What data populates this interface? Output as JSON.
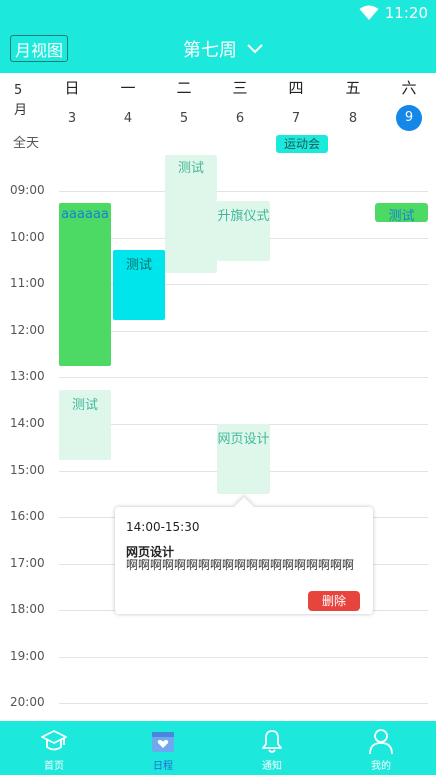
{
  "status_bar": {
    "time": "11:20",
    "wifi_icon": "wifi-icon"
  },
  "header": {
    "month_view_label": "月视图",
    "week_title": "第七周",
    "dropdown_icon": "chevron-down-icon"
  },
  "day_header": {
    "month_label": "5\n月",
    "days": [
      {
        "name": "日",
        "date": "3"
      },
      {
        "name": "一",
        "date": "4"
      },
      {
        "name": "二",
        "date": "5"
      },
      {
        "name": "三",
        "date": "6"
      },
      {
        "name": "四",
        "date": "7"
      },
      {
        "name": "五",
        "date": "8"
      },
      {
        "name": "六",
        "date": "9",
        "today": true
      }
    ],
    "today_color": "#1487e8"
  },
  "all_day": {
    "label": "全天",
    "events": [
      {
        "day": "四",
        "title": "运动会"
      }
    ]
  },
  "hours": [
    "09:00",
    "10:00",
    "11:00",
    "12:00",
    "13:00",
    "14:00",
    "15:00",
    "16:00",
    "17:00",
    "18:00",
    "19:00",
    "20:00"
  ],
  "events": [
    {
      "day": "日",
      "title": "aaaaaa"
    },
    {
      "day": "一",
      "title": "测试"
    },
    {
      "day": "二",
      "title": "测试"
    },
    {
      "day": "三",
      "title": "升旗仪式"
    },
    {
      "day": "六",
      "title": "测试"
    },
    {
      "day": "日",
      "title": "测试"
    },
    {
      "day": "三",
      "title": "网页设计"
    }
  ],
  "popup": {
    "time": "14:00-15:30",
    "title": "网页设计",
    "description": "啊啊啊啊啊啊啊啊啊啊啊啊啊啊啊啊啊啊啊",
    "delete_label": "删除"
  },
  "tabs": [
    {
      "label": "首页",
      "icon": "graduation-cap-icon"
    },
    {
      "label": "日程",
      "icon": "calendar-heart-icon",
      "active": true
    },
    {
      "label": "通知",
      "icon": "bell-icon"
    },
    {
      "label": "我的",
      "icon": "user-icon"
    }
  ],
  "colors": {
    "header_bg": "#1de8dc",
    "active_tab": "#2469d6",
    "delete_btn": "#e8443e"
  }
}
